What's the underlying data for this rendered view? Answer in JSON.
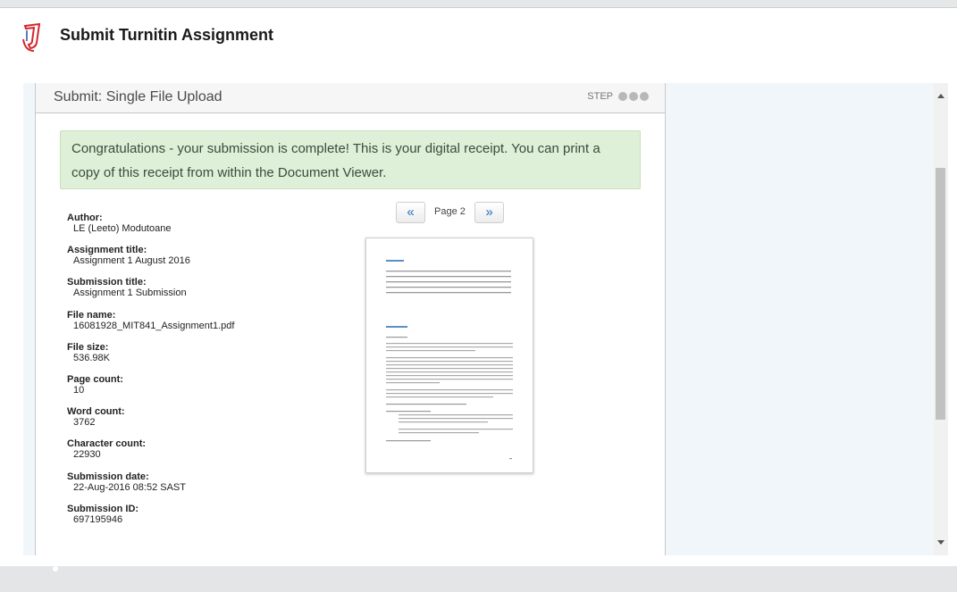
{
  "dialog": {
    "title": "Submit Turnitin Assignment"
  },
  "panel": {
    "title": "Submit: Single File Upload",
    "step_label": "STEP"
  },
  "alert": {
    "text": "Congratulations - your submission is complete! This is your digital receipt. You can print a copy of this receipt from within the Document Viewer."
  },
  "receipt": [
    {
      "label": "Author:",
      "value": "LE (Leeto) Modutoane"
    },
    {
      "label": "Assignment title:",
      "value": "Assignment 1 August 2016"
    },
    {
      "label": "Submission title:",
      "value": "Assignment 1 Submission"
    },
    {
      "label": "File name:",
      "value": "16081928_MIT841_Assignment1.pdf"
    },
    {
      "label": "File size:",
      "value": "536.98K"
    },
    {
      "label": "Page count:",
      "value": "10"
    },
    {
      "label": "Word count:",
      "value": "3762"
    },
    {
      "label": "Character count:",
      "value": "22930"
    },
    {
      "label": "Submission date:",
      "value": "22-Aug-2016 08:52 SAST"
    },
    {
      "label": "Submission ID:",
      "value": "697195946"
    }
  ],
  "viewer": {
    "prev_label": "«",
    "page_label": "Page 2",
    "next_label": "»"
  },
  "colors": {
    "alert_bg": "#dff0d8",
    "accent_blue": "#1e6fc2",
    "logo_red": "#d3262e"
  }
}
